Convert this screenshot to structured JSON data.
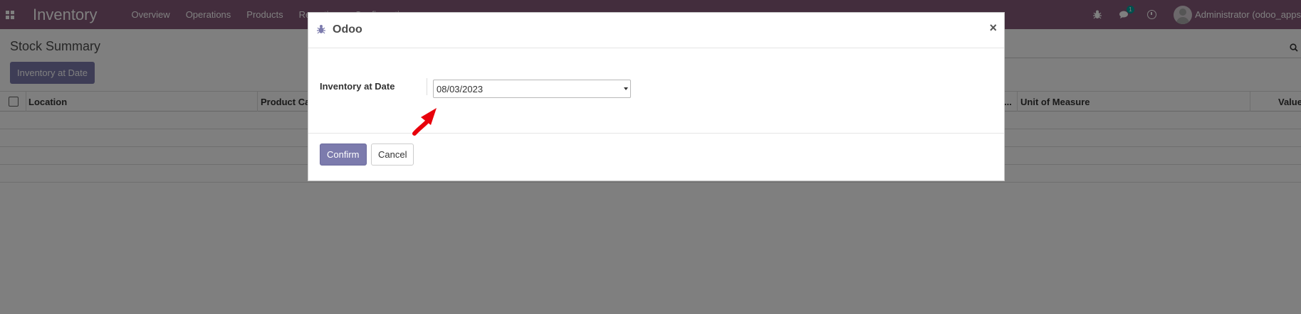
{
  "navbar": {
    "brand": "Inventory",
    "menu": [
      "Overview",
      "Operations",
      "Products",
      "Reporting",
      "Configuration"
    ],
    "notification_count": "1",
    "user": "Administrator (odoo_apps"
  },
  "control_panel": {
    "title": "Stock Summary",
    "button_label": "Inventory at Date"
  },
  "table": {
    "columns": [
      "Location",
      "Product Ca",
      "...",
      "Unit of Measure",
      "Value"
    ]
  },
  "dialog": {
    "title": "Odoo",
    "close_symbol": "×",
    "field_label": "Inventory at Date",
    "date_value": "08/03/2023",
    "confirm_label": "Confirm",
    "cancel_label": "Cancel"
  },
  "colors": {
    "navbar": "#875a7b",
    "primary_button": "#7c7bad",
    "annotation_arrow": "#e8000b"
  }
}
